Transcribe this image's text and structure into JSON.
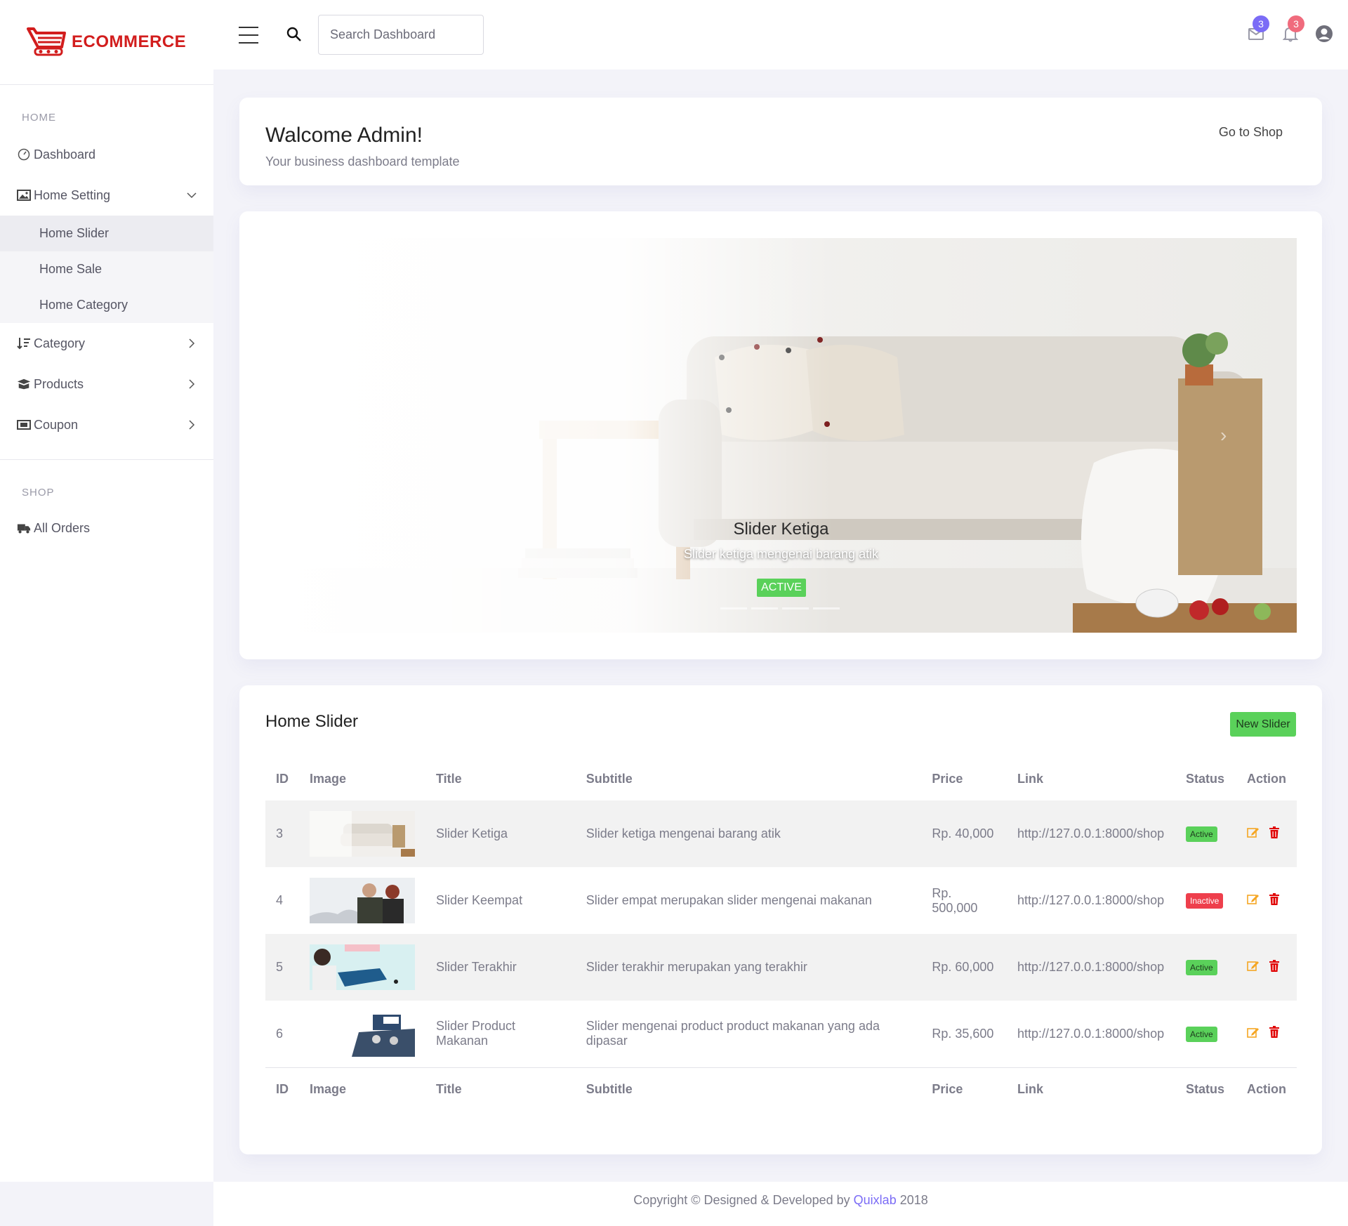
{
  "brand": {
    "name": "ECOMMERCE",
    "color": "#d21d1d"
  },
  "sidebar": {
    "section_home": "HOME",
    "section_shop": "SHOP",
    "items": [
      {
        "label": "Dashboard",
        "icon": "dashboard-gauge-icon"
      },
      {
        "label": "Home Setting",
        "icon": "image-icon",
        "expanded": true,
        "children": [
          {
            "label": "Home Slider",
            "active": true
          },
          {
            "label": "Home Sale"
          },
          {
            "label": "Home Category"
          }
        ]
      },
      {
        "label": "Category",
        "icon": "sort-icon"
      },
      {
        "label": "Products",
        "icon": "box-icon"
      },
      {
        "label": "Coupon",
        "icon": "ticket-icon"
      }
    ],
    "shop_items": [
      {
        "label": "All Orders",
        "icon": "truck-icon"
      }
    ]
  },
  "header": {
    "search_placeholder": "Search Dashboard",
    "mail_count": "3",
    "notif_count": "3"
  },
  "welcome": {
    "title": "Walcome Admin!",
    "subtitle": "Your business dashboard template",
    "shop_link": "Go to Shop"
  },
  "slider": {
    "title": "Slider Ketiga",
    "subtitle": "Slider ketiga mengenai barang atik",
    "status": "ACTIVE"
  },
  "table": {
    "title": "Home Slider",
    "new_button": "New Slider",
    "columns": [
      "ID",
      "Image",
      "Title",
      "Subtitle",
      "Price",
      "Link",
      "Status",
      "Action"
    ],
    "rows": [
      {
        "id": "3",
        "title": "Slider Ketiga",
        "subtitle": "Slider ketiga mengenai barang atik",
        "price": "Rp. 40,000",
        "link": "http://127.0.0.1:8000/shop",
        "status": "Active"
      },
      {
        "id": "4",
        "title": "Slider Keempat",
        "subtitle": "Slider empat merupakan slider mengenai makanan",
        "price": "Rp. 500,000",
        "link": "http://127.0.0.1:8000/shop",
        "status": "Inactive"
      },
      {
        "id": "5",
        "title": "Slider Terakhir",
        "subtitle": "Slider terakhir merupakan yang terakhir",
        "price": "Rp. 60,000",
        "link": "http://127.0.0.1:8000/shop",
        "status": "Active"
      },
      {
        "id": "6",
        "title": "Slider Product Makanan",
        "subtitle": "Slider mengenai product product makanan yang ada dipasar",
        "price": "Rp. 35,600",
        "link": "http://127.0.0.1:8000/shop",
        "status": "Active"
      }
    ]
  },
  "footer": {
    "prefix": "Copyright © Designed & Developed by",
    "brand": "Quixlab",
    "year": "2018"
  },
  "colors": {
    "active": "#5ad15a",
    "inactive": "#ee3f4c",
    "edit": "#f5a623",
    "delete": "#e00000",
    "badge_mail": "#7b6cf6",
    "badge_notif": "#f06b7d"
  }
}
